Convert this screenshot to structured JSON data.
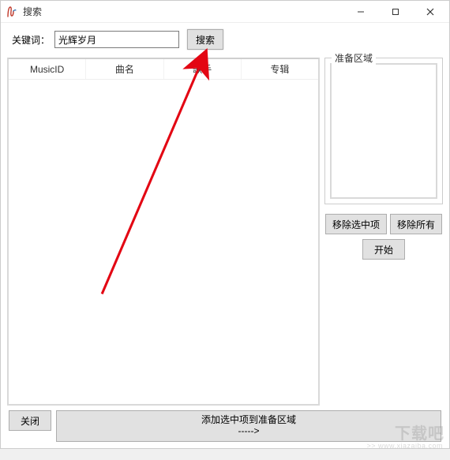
{
  "window": {
    "title": "搜索"
  },
  "search": {
    "label": "关键词：",
    "value": "光辉岁月",
    "button": "搜索"
  },
  "table": {
    "columns": [
      "MusicID",
      "曲名",
      "歌手",
      "专辑"
    ],
    "rows": []
  },
  "staging": {
    "legend": "准备区域",
    "items": [],
    "remove_selected": "移除选中项",
    "remove_all": "移除所有",
    "start": "开始"
  },
  "footer": {
    "close": "关闭",
    "add_to_staging_line1": "添加选中项到准备区域",
    "add_to_staging_line2": "----->"
  },
  "annotation": {
    "arrow_color": "#e30613"
  },
  "watermark": {
    "main": "下载吧",
    "sub": ">> www.xiazaiba.com"
  }
}
